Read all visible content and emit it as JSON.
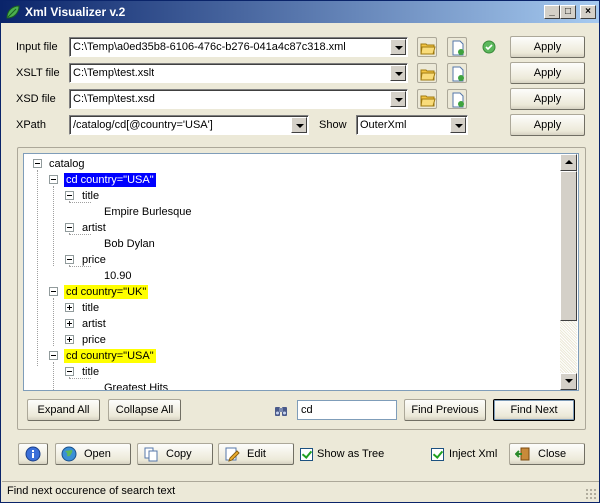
{
  "window": {
    "title": "Xml Visualizer v.2"
  },
  "labels": {
    "input_file": "Input file",
    "xslt_file": "XSLT file",
    "xsd_file": "XSD file",
    "xpath": "XPath",
    "show": "Show"
  },
  "fields": {
    "input_file": "C:\\Temp\\a0ed35b8-6106-476c-b276-041a4c87c318.xml",
    "xslt_file": "C:\\Temp\\test.xslt",
    "xsd_file": "C:\\Temp\\test.xsd",
    "xpath": "/catalog/cd[@country='USA']",
    "show": "OuterXml",
    "search": "cd"
  },
  "buttons": {
    "apply": "Apply",
    "expand_all": "Expand All",
    "collapse_all": "Collapse All",
    "find_previous": "Find Previous",
    "find_next": "Find Next",
    "open": "Open",
    "copy": "Copy",
    "edit": "Edit",
    "close": "Close"
  },
  "checkboxes": {
    "show_as_tree": "Show as Tree",
    "inject_xml": "Inject Xml"
  },
  "tree": {
    "root": "catalog",
    "cd1": "cd country=\"USA\"",
    "cd1_title": "title",
    "cd1_title_val": "Empire Burlesque",
    "cd1_artist": "artist",
    "cd1_artist_val": "Bob Dylan",
    "cd1_price": "price",
    "cd1_price_val": "10.90",
    "cd2": "cd country=\"UK\"",
    "cd2_title": "title",
    "cd2_artist": "artist",
    "cd2_price": "price",
    "cd3": "cd country=\"USA\"",
    "cd3_title": "title",
    "cd3_title_val": "Greatest Hits"
  },
  "status": {
    "text": "Find next occurence of search text"
  },
  "colors": {
    "selected": "#0000ff",
    "match": "#ffff00",
    "titlebar": "#0a246a"
  }
}
